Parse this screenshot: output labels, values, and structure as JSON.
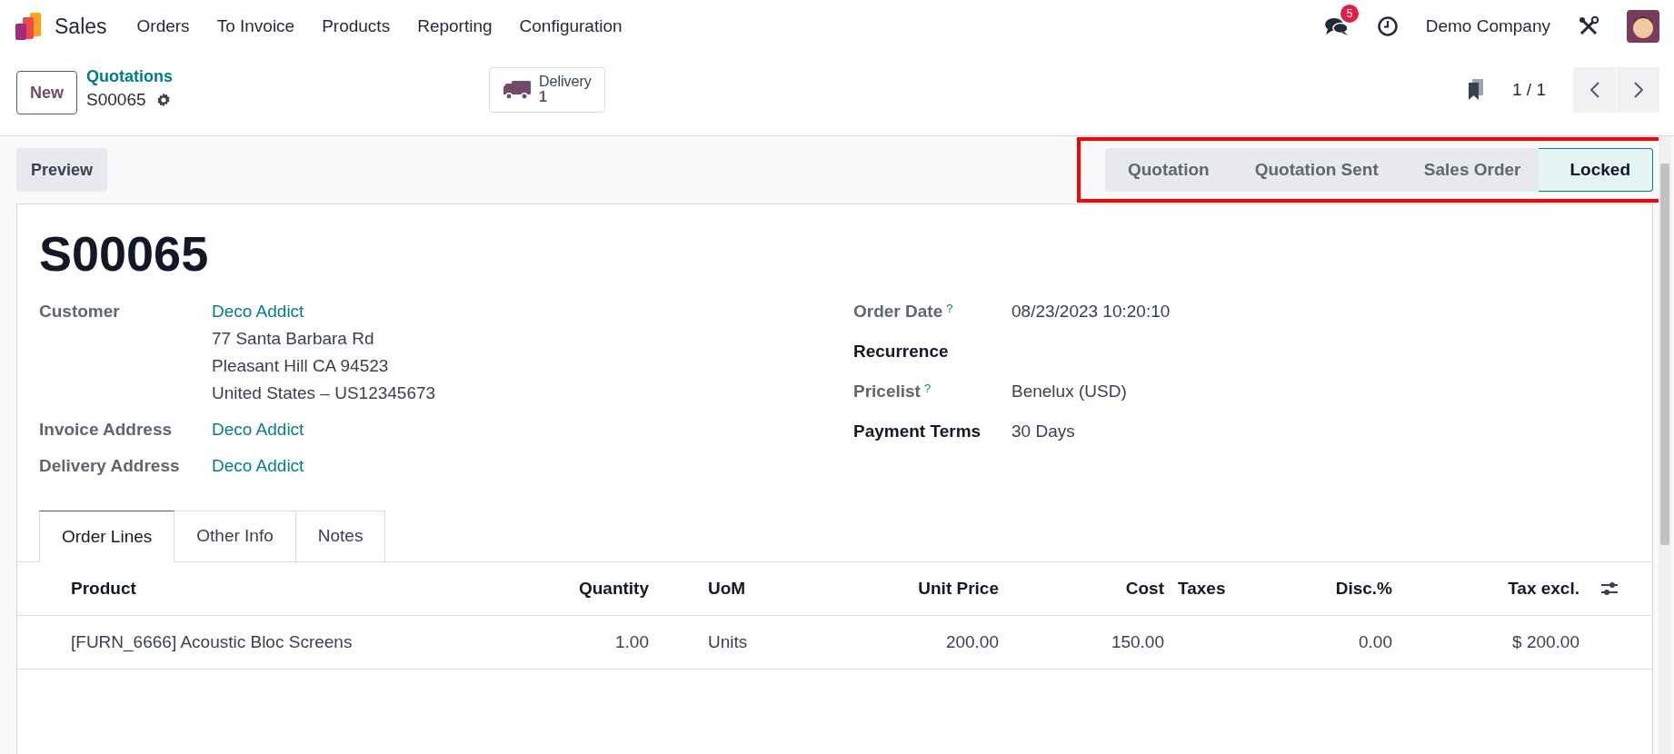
{
  "navbar": {
    "app": "Sales",
    "menus": [
      "Orders",
      "To Invoice",
      "Products",
      "Reporting",
      "Configuration"
    ],
    "messages_badge": "5",
    "company": "Demo Company"
  },
  "control_panel": {
    "new_button": "New",
    "breadcrumb": "Quotations",
    "record": "S00065",
    "smart_button": {
      "label": "Delivery",
      "count": "1"
    },
    "pager": "1 / 1"
  },
  "action_buttons": [
    "Preview"
  ],
  "stages": [
    {
      "label": "Quotation",
      "selected": false
    },
    {
      "label": "Quotation Sent",
      "selected": false
    },
    {
      "label": "Sales Order",
      "selected": false
    },
    {
      "label": "Locked",
      "selected": true
    }
  ],
  "title": "S00065",
  "left_fields": [
    {
      "label": "Customer",
      "value": "Deco Addict",
      "address": [
        "77 Santa Barbara Rd",
        "Pleasant Hill CA 94523",
        "United States – US12345673"
      ]
    },
    {
      "label": "Invoice Address",
      "value": "Deco Addict"
    },
    {
      "label": "Delivery Address",
      "value": "Deco Addict"
    }
  ],
  "right_fields": [
    {
      "label": "Order Date",
      "help": "?",
      "value": "08/23/2023 10:20:10",
      "required": false
    },
    {
      "label": "Recurrence",
      "required": true
    },
    {
      "label": "Pricelist",
      "help": "?",
      "value": "Benelux (USD)",
      "required": false
    },
    {
      "label": "Payment Terms",
      "value": "30 Days",
      "required": true
    }
  ],
  "tabs": [
    {
      "label": "Order Lines",
      "selected": true
    },
    {
      "label": "Other Info",
      "selected": false
    },
    {
      "label": "Notes",
      "selected": false
    }
  ],
  "table": {
    "columns": [
      "Product",
      "Quantity",
      "UoM",
      "Unit Price",
      "Cost",
      "Taxes",
      "Disc.%",
      "Tax excl."
    ],
    "rows": [
      [
        "[FURN_6666] Acoustic Bloc Screens",
        "1.00",
        "Units",
        "200.00",
        "150.00",
        "",
        "0.00",
        "$ 200.00"
      ]
    ]
  }
}
